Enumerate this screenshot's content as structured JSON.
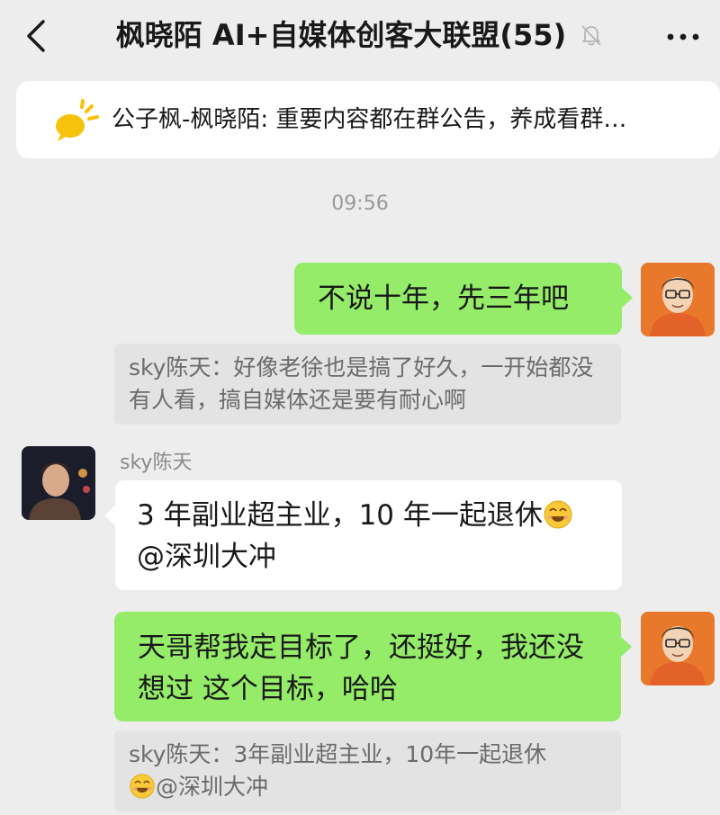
{
  "header": {
    "title": "枫晓陌 AI+自媒体创客大联盟(55)",
    "back_icon": "chevron-left-icon",
    "mute_icon": "bell-muted-icon",
    "more_icon": "more-dots-icon"
  },
  "notice": {
    "icon": "megaphone-icon",
    "text": "公子枫-枫晓陌: 重要内容都在群公告，养成看群…"
  },
  "chat": {
    "timestamp": "09:56",
    "messages": [
      {
        "side": "right",
        "text": "不说十年，先三年吧",
        "quote": "sky陈天：好像老徐也是搞了好久，一开始都没有人看，搞自媒体还是要有耐心啊"
      },
      {
        "side": "left",
        "sender": "sky陈天",
        "text_part1": "3 年副业超主业，10 年一起退休",
        "text_part2": "@深圳大冲",
        "emoji": "grinning-face-emoji"
      },
      {
        "side": "right",
        "text": "天哥帮我定目标了，还挺好，我还没想过 这个目标，哈哈",
        "quote_part1": "sky陈天：3年副业超主业，10年一起退休",
        "quote_part2": "@深圳大冲"
      }
    ]
  },
  "colors": {
    "background": "#ededed",
    "green_bubble": "#95ec69",
    "white_bubble": "#ffffff",
    "quote_bg": "#e3e3e3"
  }
}
